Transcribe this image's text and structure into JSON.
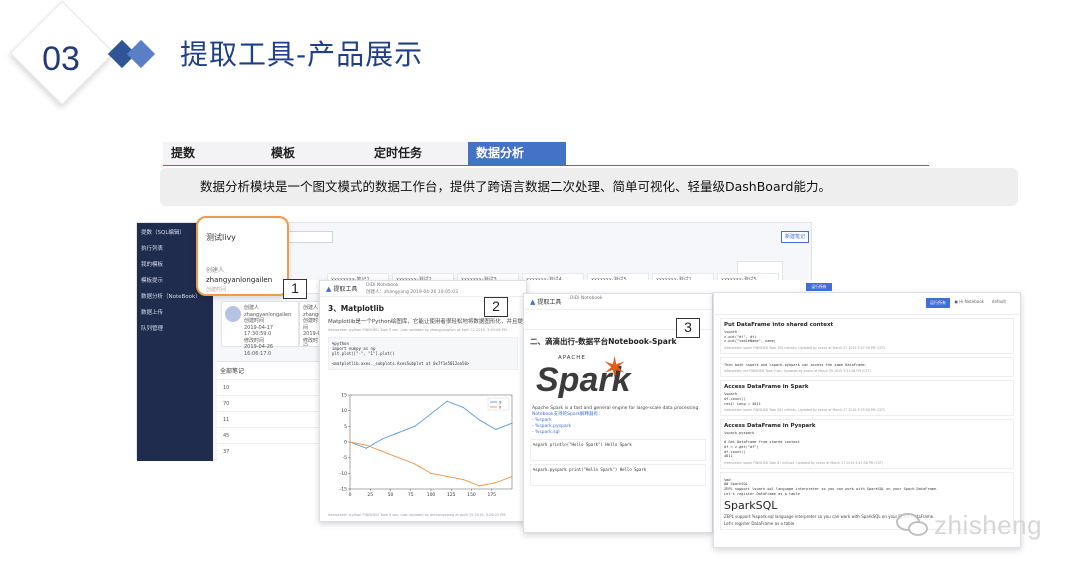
{
  "header": {
    "section_number": "03",
    "title": "提取工具-产品展示"
  },
  "tabs": [
    {
      "label": "提数"
    },
    {
      "label": "模板"
    },
    {
      "label": "定时任务"
    },
    {
      "label": "数据分析"
    }
  ],
  "active_tab": "数据分析",
  "description": "数据分析模块是一个图文模式的数据工作台，提供了跨语言数据二次处理、简单可视化、轻量级DashBoard能力。",
  "app": {
    "sidebar": [
      "提数（SQL编辑）",
      "执行列表",
      "我的模板",
      "模板提示",
      "数据分析（NoteBook）",
      "数据上传",
      "队列管理"
    ],
    "search_placeholder": "Q",
    "top_button": "新建笔记",
    "note_cards": [
      "xxxxxxxx-笔记1",
      "xxxxxxx-测试2",
      "xxxxxxx-测试3",
      "xxxxxxx-测试4",
      "xxxxxxx-测试5",
      "xxxxxxx-测试1",
      "xxxxxxx-测试5"
    ],
    "user_card": {
      "lines": [
        "创建人",
        "zhangyanlongailen",
        "创建时间",
        "2019-04-17 17:30:59.0",
        "修改时间",
        "2019-04-26 16:06:17.0"
      ]
    },
    "user_card2": [
      "创建人",
      "zhango",
      "创建时间",
      "2019-0",
      "修改时间",
      "2019-0"
    ],
    "list_title": "全部笔记",
    "list_rows": [
      "10",
      "70",
      "11",
      "45",
      "37"
    ],
    "popup": {
      "title": "测试livy",
      "label": "创建人",
      "user": "zhangyanlongailen",
      "sub": "创建时间"
    }
  },
  "panel1": {
    "header": "提取工具",
    "meta_title": "DiDi Notebook",
    "meta_sub": "创建人：zhangyang  2019-04-26 10:05:03",
    "section": "3、Matplotlib",
    "text": "Matplotlib是一个Python绘图库，它能让使用者很轻松地将数据图形化，并且提供多样化的输出格式。",
    "meta_line": "Interpreter: python  FINISHED  Took 0 sec. Last updated by zhangyanglian at April 22 2019, 3:03:08 PM.",
    "code": "%python\nimport numpy as np\nplt.plot([\"-\", \"1\"].plot()\n\n<matplotlib.axes._subplots.AxesSubplot at 0x7f1e5012ea50>",
    "legend": [
      "y",
      "x"
    ],
    "footer_meta": "Interpreter: python  FINISHED  Took 0 sec. Last updated by anthongxiang at April 29 2019, 3:26:22 PM."
  },
  "panel2": {
    "header": "提取工具",
    "meta_title": "DiDi Notebook",
    "title": "二、滴滴出行-数据平台Notebook-Spark",
    "apache": "APACHE",
    "spark": "Spark",
    "desc": "Apache Spark is a fast and general engine for large-scale data processing.",
    "desc2": "Notebook支持的Spark解释器有：",
    "list": [
      "- %spark",
      "- %spark.pyspark",
      "- %spark.sql"
    ],
    "code1": "%spark\nprintln(\"Hello Spark\")\nHello Spark",
    "code2": "%spark.pyspark\nprint(\"Hello Spark\")\nHello Spark"
  },
  "panel3": {
    "run_button": "运行所有",
    "status": "● Hi-Notebook",
    "default": "default",
    "blocks": [
      {
        "title": "Put DataFrame into shared context",
        "code": "%spark\nz.put(\"df\", df)\nz.put(\"tableName\", name)",
        "meta": "Interpreter: spark  FINISHED  Took 700 millisec. Updated by xxxxx at March 27 2019 3:47:59 PM (CST)"
      },
      {
        "title": "",
        "code": "Then both %spark and %spark.pyspark can access the same DataFrame.",
        "meta": "Interpreter: md  FINISHED  Took 0 sec. Updated by xxxxx at March 29 2019 3:51:58 PM (CST)"
      },
      {
        "title": "Access DataFrame in Spark",
        "code": "%spark\ndf.count()\nres1: Long = 4011",
        "meta": "Interpreter: spark  FINISHED  Took 261 millisec. Updated by xxxxx at March 27 2019 3:33:58 PM (CST)"
      },
      {
        "title": "Access DataFrame in Pyspark",
        "code": "%spark.pyspark\n\n# Get DataFrame from shared context\ndf = z.get(\"df\")\ndf.count()\n4011",
        "meta": "Interpreter: spark  FINISHED  Took 87 millisec. Updated by xxxxx at March 27 2019 3:47:58 PM (CST)"
      }
    ],
    "sparksql_intro": "%md\n## SparkSQL\nZEPL support %spark.sql language interpreter so you can work with SparkSQL on your Spark DataFrame.\nLet's register DataFrame as a table",
    "sparksql_title": "SparkSQL",
    "sparksql_text": "ZEPL support %spark.sql language interpreter so you can work with SparkSQL on your Spark DataFrame.",
    "sparksql_text2": "Let's register DataFrame as a table"
  },
  "steps": [
    "1",
    "2",
    "3"
  ],
  "watermark": "zhisheng",
  "colors": {
    "brand": "#1f3f88",
    "tab_active": "#4472c4",
    "popup_border": "#ef9b4e",
    "series_y": "#5b9bd5",
    "series_x": "#ed9444"
  },
  "chart_data": {
    "type": "line",
    "x": [
      0,
      20,
      40,
      60,
      80,
      100,
      120,
      140,
      160,
      180,
      200
    ],
    "series": [
      {
        "name": "y",
        "values": [
          0,
          -2,
          1,
          3,
          5,
          9,
          13,
          11,
          7,
          4,
          6
        ]
      },
      {
        "name": "x",
        "values": [
          0,
          -1,
          -3,
          -5,
          -7,
          -10,
          -11,
          -12,
          -14,
          -13,
          -11
        ]
      }
    ],
    "xlim": [
      0,
      200
    ],
    "ylim": [
      -15,
      15
    ],
    "xticks": [
      0,
      25,
      50,
      75,
      100,
      125,
      150,
      175
    ],
    "yticks": [
      -15,
      -10,
      -5,
      0,
      5,
      10,
      15
    ],
    "legend": "top-right"
  }
}
